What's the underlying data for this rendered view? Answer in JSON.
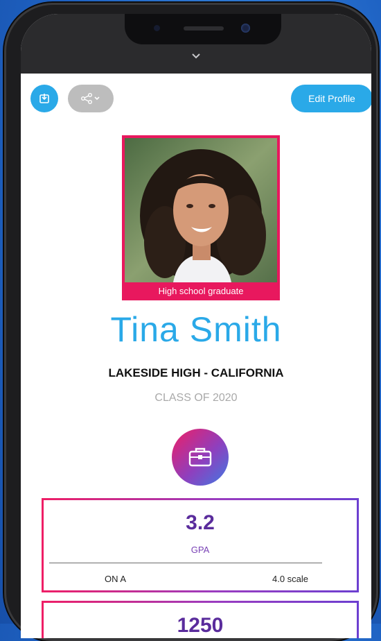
{
  "profile": {
    "caption": "High school graduate",
    "name": "Tina Smith",
    "school": "LAKESIDE HIGH - CALIFORNIA",
    "class_of": "CLASS OF 2020"
  },
  "actions": {
    "edit_profile": "Edit Profile"
  },
  "icons": [
    "save-icon",
    "share-icon",
    "briefcase-icon",
    "chevron-down-icon"
  ],
  "stats": {
    "gpa": {
      "value": "3.2",
      "label": "GPA",
      "footer_left": "ON A",
      "footer_right": "4.0 scale"
    },
    "sat": {
      "value": "1250"
    }
  },
  "colors": {
    "accent_blue": "#2aa9e8",
    "accent_pink": "#e8185e",
    "accent_purple": "#5a2c9c"
  }
}
